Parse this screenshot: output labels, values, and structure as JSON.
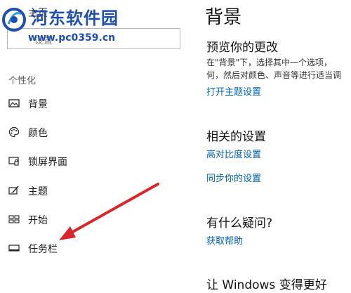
{
  "watermark": {
    "title": "河东软件园",
    "url": "www.pc0359.cn"
  },
  "sidebar": {
    "home_label": "主页",
    "search_placeholder": "设置",
    "section_label": "个性化",
    "items": [
      {
        "label": "背景",
        "icon": "picture-icon",
        "active": true
      },
      {
        "label": "颜色",
        "icon": "palette-icon"
      },
      {
        "label": "锁屏界面",
        "icon": "lock-screen-icon"
      },
      {
        "label": "主题",
        "icon": "theme-brush-icon"
      },
      {
        "label": "开始",
        "icon": "start-grid-icon"
      },
      {
        "label": "任务栏",
        "icon": "taskbar-icon"
      }
    ]
  },
  "main": {
    "title": "背景",
    "preview": {
      "heading": "预览你的更改",
      "desc_line1": "在\"背景\"下，选择其中一个选项，",
      "desc_line2": "何，然后对颜色、声音等进行适当调",
      "link": "打开主题设置"
    },
    "related": {
      "heading": "相关的设置",
      "links": [
        "高对比度设置",
        "同步你的设置"
      ]
    },
    "help": {
      "heading": "有什么疑问?",
      "link": "获取帮助"
    },
    "improve": {
      "heading": "让 Windows 变得更好"
    }
  },
  "colors": {
    "accent_link": "#0063b1",
    "arrow": "#d9262b",
    "watermark": "#1f4fae"
  }
}
